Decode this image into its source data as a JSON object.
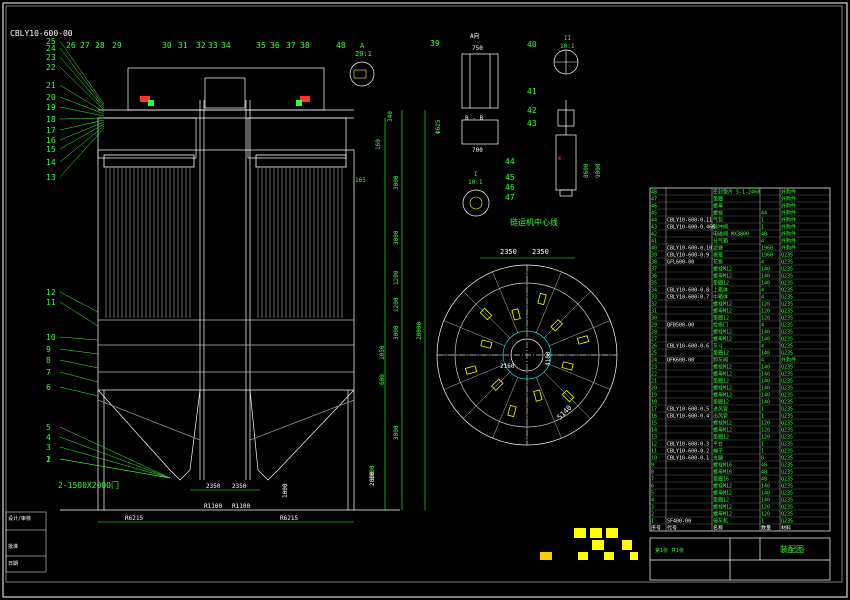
{
  "drawing": {
    "code": "CBLY10-600-00",
    "title": "装配图",
    "note_left": "2-1500X2000门",
    "center_label": "链运机中心线",
    "detail_A": "A",
    "detail_A_scale": "20:1",
    "view_A": "A向",
    "section_BB": "B - B",
    "scale_I": "I",
    "scale_I_ratio": "10:1",
    "scale_II": "II",
    "scale_II_ratio": "10:1",
    "bottom_left_labels": [
      "设计/审核",
      "批准",
      "日期"
    ],
    "title_block_note": "第1张 共1张"
  },
  "left_numbers": [
    "25",
    "24",
    "23",
    "22",
    "21",
    "20",
    "19",
    "18",
    "17",
    "16",
    "15",
    "14",
    "13",
    "12",
    "11",
    "10",
    "9",
    "8",
    "7",
    "6",
    "5",
    "4",
    "3",
    "2",
    "1"
  ],
  "top_numbers": [
    "26",
    "27",
    "28",
    "29",
    "30",
    "31",
    "32",
    "33",
    "34",
    "35",
    "36",
    "37",
    "38"
  ],
  "mid_numbers": [
    "48",
    "39",
    "40",
    "41",
    "42",
    "43",
    "44",
    "45",
    "46",
    "47"
  ],
  "dims": {
    "right_side": [
      "340",
      "160",
      "3000",
      "3000",
      "1200",
      "1200",
      "3000",
      "1050",
      "600",
      "3000",
      "3000",
      "20000"
    ],
    "width_top": "750",
    "width_bb": "700",
    "d_left": "R6215",
    "d_right": "R6215",
    "d_c1": "R1100",
    "d_c2": "R1100",
    "bottom_1": "2350",
    "bottom_2": "2350",
    "bottom_3": "1000",
    "bottom_4": "2000",
    "circle_1": "2350",
    "circle_2": "2350",
    "circle_3": "5140",
    "circle_4": "2160",
    "circle_5": "4100",
    "dim_165": "165",
    "dim_8600": "8600",
    "dim_9000": "9000",
    "dim_9625": "Φ625"
  },
  "bom": {
    "rows": [
      [
        "48",
        "",
        "密封垫片 5-1-2468",
        "",
        "外购件"
      ],
      [
        "47",
        "",
        "垫圈",
        "",
        "外购件"
      ],
      [
        "46",
        "",
        "螺母",
        "",
        "外购件"
      ],
      [
        "45",
        "",
        "螺栓",
        "44",
        "外购件"
      ],
      [
        "44",
        "CBLY10-600-0.11",
        "气包",
        "1",
        "外购件"
      ],
      [
        "43",
        "CBLY10-600-0.466",
        "脉冲阀",
        "1",
        "外购件"
      ],
      [
        "42",
        "",
        "电磁阀 MX3800",
        "48",
        "外购件"
      ],
      [
        "41",
        "",
        "分气箱",
        "4",
        "外购件"
      ],
      [
        "40",
        "CBLY10-600-0.10",
        "滤袋",
        "1960",
        "外购件"
      ],
      [
        "39",
        "CBLY10-600-0.9",
        "袋笼",
        "1960",
        "Q235"
      ],
      [
        "38",
        "GFL600-00",
        "花板",
        "4",
        "Q235"
      ],
      [
        "37",
        "",
        "螺栓M12",
        "140",
        "Q235"
      ],
      [
        "36",
        "",
        "螺母M12",
        "140",
        "Q235"
      ],
      [
        "35",
        "",
        "垫圈12",
        "140",
        "Q235"
      ],
      [
        "34",
        "CBLY10-600-0.8",
        "上箱体",
        "4",
        "Q235"
      ],
      [
        "33",
        "CBLY10-600-0.7",
        "中箱体",
        "4",
        "Q235"
      ],
      [
        "32",
        "",
        "螺栓M12",
        "120",
        "Q235"
      ],
      [
        "31",
        "",
        "螺母M12",
        "120",
        "Q235"
      ],
      [
        "30",
        "",
        "垫圈12",
        "120",
        "Q235"
      ],
      [
        "29",
        "QFB500-00",
        "检修门",
        "4",
        "Q235"
      ],
      [
        "28",
        "",
        "螺栓M12",
        "140",
        "Q235"
      ],
      [
        "27",
        "",
        "螺母M12",
        "140",
        "Q235"
      ],
      [
        "26",
        "CBLY10-600-0.6",
        "灰斗",
        "4",
        "Q235"
      ],
      [
        "25",
        "",
        "垫圈12",
        "140",
        "Q235"
      ],
      [
        "24",
        "QFK600-00",
        "卸灰阀",
        "4",
        "外购件"
      ],
      [
        "23",
        "",
        "螺栓M12",
        "140",
        "Q235"
      ],
      [
        "22",
        "",
        "螺母M12",
        "140",
        "Q235"
      ],
      [
        "21",
        "",
        "垫圈12",
        "140",
        "Q235"
      ],
      [
        "20",
        "",
        "螺栓M12",
        "140",
        "Q235"
      ],
      [
        "19",
        "",
        "螺母M12",
        "140",
        "Q235"
      ],
      [
        "18",
        "",
        "垫圈12",
        "140",
        "Q235"
      ],
      [
        "17",
        "CBLY10-600-0.5",
        "进风管",
        "1",
        "Q235"
      ],
      [
        "16",
        "CBLY10-600-0.4",
        "出风管",
        "1",
        "Q235"
      ],
      [
        "15",
        "",
        "螺栓M12",
        "120",
        "Q235"
      ],
      [
        "14",
        "",
        "螺母M12",
        "120",
        "Q235"
      ],
      [
        "13",
        "",
        "垫圈12",
        "120",
        "Q235"
      ],
      [
        "12",
        "CBLY10-600-0.3",
        "平台",
        "1",
        "Q235"
      ],
      [
        "11",
        "CBLY10-600-0.2",
        "梯子",
        "1",
        "Q235"
      ],
      [
        "10",
        "CBLY10-600-0.1",
        "支腿",
        "8",
        "Q235"
      ],
      [
        "9",
        "",
        "螺栓M16",
        "48",
        "Q235"
      ],
      [
        "8",
        "",
        "螺母M16",
        "48",
        "Q235"
      ],
      [
        "7",
        "",
        "垫圈16",
        "48",
        "Q235"
      ],
      [
        "6",
        "",
        "螺栓M12",
        "140",
        "Q235"
      ],
      [
        "5",
        "",
        "螺母M12",
        "140",
        "Q235"
      ],
      [
        "4",
        "",
        "垫圈12",
        "140",
        "Q235"
      ],
      [
        "3",
        "",
        "螺栓M12",
        "120",
        "Q235"
      ],
      [
        "2",
        "",
        "螺母M12",
        "120",
        "Q235"
      ],
      [
        "1",
        "SF400-00",
        "输灰机",
        "1",
        "Q235"
      ]
    ],
    "header": [
      "序号",
      "代号",
      "名称",
      "数量",
      "材料"
    ]
  },
  "colors": {
    "outline": "#ffffff",
    "green": "#33ff33",
    "cyan": "#00e5e5",
    "yellow": "#ffff00",
    "red": "#ff3333",
    "dim": "#6ff56f"
  }
}
